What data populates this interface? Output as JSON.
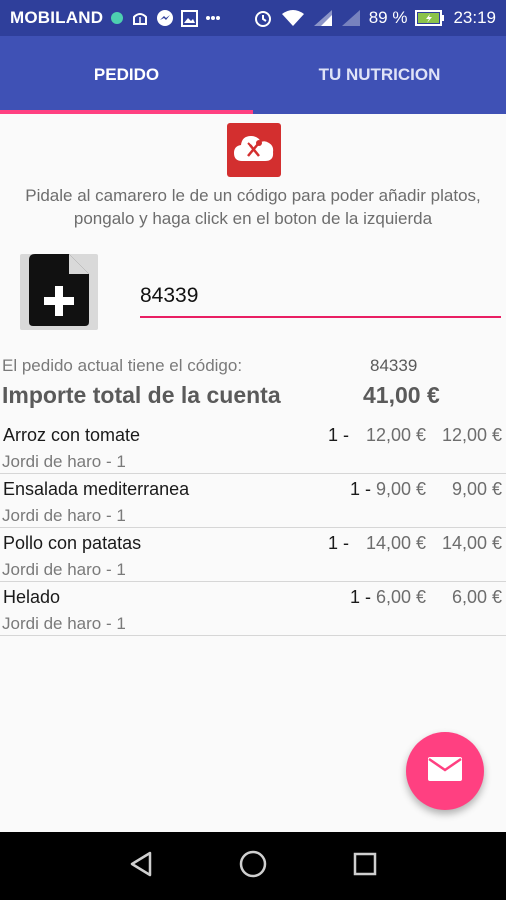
{
  "status_bar": {
    "carrier": "MOBILAND",
    "battery": "89 %",
    "time": "23:19",
    "icons": [
      "signal-dot-icon",
      "android-debug-icon",
      "messenger-icon",
      "image-icon",
      "more-dots-icon",
      "alarm-icon",
      "wifi-icon",
      "cell-signal-icon",
      "cell-signal-off-icon",
      "battery-charging-icon"
    ]
  },
  "tabs": [
    {
      "label": "PEDIDO",
      "active": true
    },
    {
      "label": "TU NUTRICION",
      "active": false
    }
  ],
  "colors": {
    "primary": "#3f51b5",
    "status_bar": "#2f3f9b",
    "accent": "#ff4081",
    "cloud_button": "#d32f2f"
  },
  "content": {
    "cloud_icon": "cloud-cutlery-icon",
    "instructions": "Pidale al camarero le de un código para poder añadir platos, pongalo y haga click en el boton de la izquierda",
    "add_document_icon": "add-document-icon",
    "code_input_value": "84339",
    "order_label": "El pedido actual tiene el código:",
    "order_code": "84339",
    "total_label": "Importe total de la cuenta",
    "total_value": "41,00 €",
    "items": [
      {
        "name": "Arroz con tomate",
        "qty": "1 -",
        "price": "12,00 €",
        "subtotal": "12,00 €",
        "waiter": "Jordi de haro - 1"
      },
      {
        "name": "Ensalada mediterranea",
        "qty": "1 -",
        "price": "9,00 €",
        "subtotal": "9,00 €",
        "waiter": "Jordi de haro - 1"
      },
      {
        "name": "Pollo con patatas",
        "qty": "1 -",
        "price": "14,00 €",
        "subtotal": "14,00 €",
        "waiter": "Jordi de haro - 1"
      },
      {
        "name": "Helado",
        "qty": "1 -",
        "price": "6,00 €",
        "subtotal": "6,00 €",
        "waiter": "Jordi de haro - 1"
      }
    ],
    "fab_icon": "email-icon"
  },
  "nav_bar": {
    "buttons": [
      "back-triangle-icon",
      "home-circle-icon",
      "recents-square-icon"
    ]
  }
}
